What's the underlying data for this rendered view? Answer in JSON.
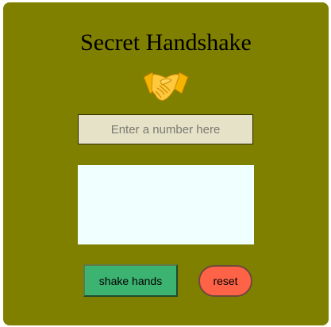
{
  "app": {
    "title": "Secret Handshake",
    "icon": "handshake-icon"
  },
  "input": {
    "placeholder": "Enter a number here",
    "value": ""
  },
  "output": {
    "text": ""
  },
  "buttons": {
    "shake_label": "shake hands",
    "reset_label": "reset"
  },
  "colors": {
    "card_background": "#808000",
    "input_background": "#e5e2c8",
    "output_background": "#f0ffff",
    "shake_button": "#3cb371",
    "reset_button": "#ff6347"
  }
}
